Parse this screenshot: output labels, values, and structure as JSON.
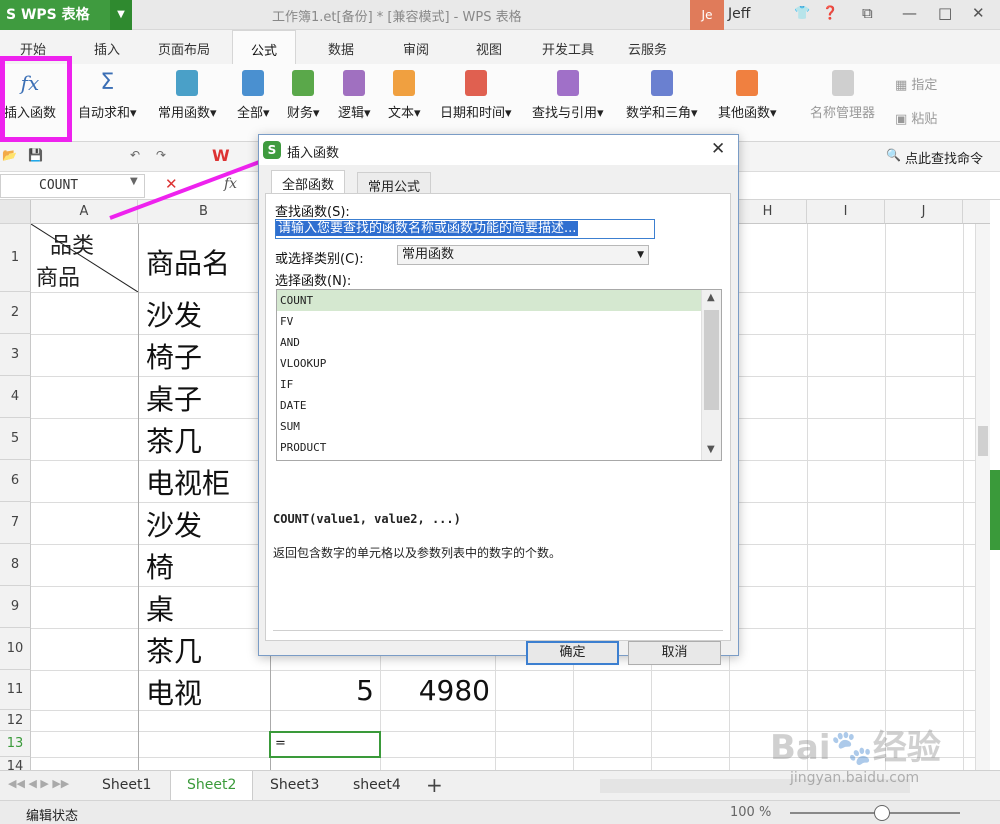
{
  "app": {
    "name": "WPS 表格",
    "doc_title": "工作簿1.et[备份] * [兼容模式] - WPS 表格",
    "user_initials": "Je",
    "user_name": "Jeff"
  },
  "ribbon_tabs": [
    "开始",
    "插入",
    "页面布局",
    "公式",
    "数据",
    "审阅",
    "视图",
    "开发工具",
    "云服务"
  ],
  "active_tab": "公式",
  "ribbon_buttons": [
    {
      "label": "插入函数",
      "icon": "fx-icon",
      "color": "#3b6fb5"
    },
    {
      "label": "自动求和",
      "icon": "sigma-icon",
      "color": "#3b6fb5"
    },
    {
      "label": "常用函数",
      "icon": "star-book-icon",
      "color": "#4aa0c8"
    },
    {
      "label": "全部",
      "icon": "book-icon",
      "color": "#4a90d0"
    },
    {
      "label": "财务",
      "icon": "finance-book-icon",
      "color": "#5aa84a"
    },
    {
      "label": "逻辑",
      "icon": "logic-book-icon",
      "color": "#a070c0"
    },
    {
      "label": "文本",
      "icon": "text-book-icon",
      "color": "#f0a040"
    },
    {
      "label": "日期和时间",
      "icon": "clock-book-icon",
      "color": "#e06050"
    },
    {
      "label": "查找与引用",
      "icon": "search-book-icon",
      "color": "#a070c8"
    },
    {
      "label": "数学和三角",
      "icon": "math-book-icon",
      "color": "#6a80d0"
    },
    {
      "label": "其他函数",
      "icon": "more-book-icon",
      "color": "#f08040"
    }
  ],
  "ribbon_right": {
    "name_manager": "名称管理器",
    "define": "指定",
    "paste": "粘贴"
  },
  "quick_toolbar": {
    "search_command": "点此查找命令"
  },
  "formula_bar": {
    "name_box": "COUNT",
    "fx": "fx"
  },
  "columns": [
    "A",
    "B",
    "",
    "",
    "",
    "",
    "",
    "H",
    "I",
    "J"
  ],
  "rows": [
    "1",
    "2",
    "3",
    "4",
    "5",
    "6",
    "7",
    "8",
    "9",
    "10",
    "11",
    "12",
    "13",
    "14"
  ],
  "cells": {
    "a1_top": "品类",
    "a1_bottom": "商品",
    "b_col": [
      "商品名",
      "沙发",
      "椅子",
      "桌子",
      "茶几",
      "电视柜",
      "沙发",
      "椅",
      "桌",
      "茶几",
      "电视"
    ],
    "c11": "5",
    "d11": "4980",
    "c13": "="
  },
  "sheet_tabs": [
    "Sheet1",
    "Sheet2",
    "Sheet3",
    "sheet4"
  ],
  "active_sheet": "Sheet2",
  "status": {
    "mode": "编辑状态",
    "zoom": "100 %"
  },
  "dialog": {
    "title": "插入函数",
    "tabs": [
      "全部函数",
      "常用公式"
    ],
    "search_label": "查找函数(S):",
    "search_value": "请输入您要查找的函数名称或函数功能的简要描述...",
    "category_label": "或选择类别(C):",
    "category_value": "常用函数",
    "select_label": "选择函数(N):",
    "functions": [
      "COUNT",
      "FV",
      "AND",
      "VLOOKUP",
      "IF",
      "DATE",
      "SUM",
      "PRODUCT"
    ],
    "selected_function": "COUNT",
    "syntax": "COUNT(value1, value2, ...)",
    "description": "返回包含数字的单元格以及参数列表中的数字的个数。",
    "ok": "确定",
    "cancel": "取消"
  },
  "watermark": {
    "brand": "Bai",
    "brand2": "经验",
    "url": "jingyan.baidu.com"
  },
  "colors": {
    "wps_green": "#3f9b3f",
    "highlight": "#ee22ee",
    "selection": "#d5e8d0"
  }
}
